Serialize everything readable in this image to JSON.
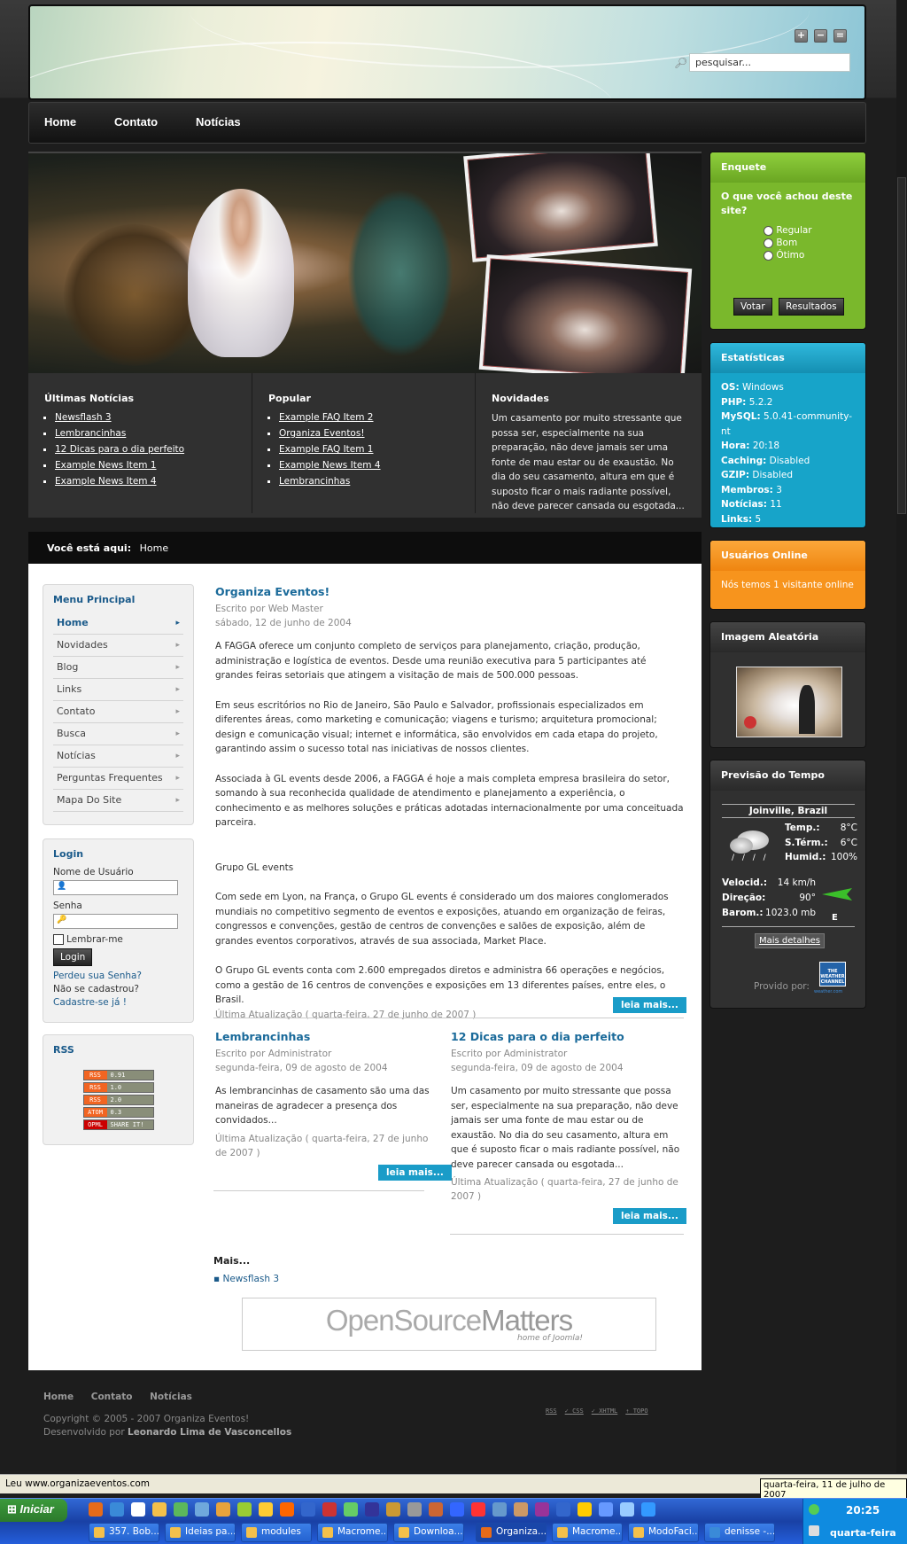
{
  "header": {
    "search_placeholder": "pesquisar..."
  },
  "nav": {
    "items": [
      "Home",
      "Contato",
      "Notícias"
    ]
  },
  "news_columns": {
    "latest": {
      "title": "Últimas Notícias",
      "items": [
        "Newsflash 3",
        "Lembrancinhas",
        "12 Dicas para o dia perfeito",
        "Example News Item 1",
        "Example News Item 4"
      ]
    },
    "popular": {
      "title": "Popular",
      "items": [
        "Example FAQ Item 2",
        "Organiza Eventos!",
        "Example FAQ Item 1",
        "Example News Item 4",
        "Lembrancinhas"
      ]
    },
    "news": {
      "title": "Novidades",
      "text": "Um casamento por muito stressante que possa ser, especialmente na sua preparação, não deve jamais ser uma fonte de mau estar ou de exaustão. No dia do seu casamento, altura em que é suposto ficar o mais radiante possível, não deve parecer cansada ou esgotada..."
    }
  },
  "breadcrumb": {
    "label": "Você está aqui:",
    "current": "Home"
  },
  "main_menu": {
    "title": "Menu Principal",
    "items": [
      "Home",
      "Novidades",
      "Blog",
      "Links",
      "Contato",
      "Busca",
      "Notícias",
      "Perguntas Frequentes",
      "Mapa Do Site"
    ]
  },
  "login": {
    "title": "Login",
    "username_label": "Nome de Usuário",
    "password_label": "Senha",
    "remember_label": "Lembrar-me",
    "button": "Login",
    "forgot": "Perdeu sua Senha?",
    "not_registered": "Não se cadastrou?",
    "register": "Cadastre-se já !"
  },
  "rss": {
    "title": "RSS",
    "feeds": [
      {
        "a": "RSS",
        "b": "0.91"
      },
      {
        "a": "RSS",
        "b": "1.0"
      },
      {
        "a": "RSS",
        "b": "2.0"
      },
      {
        "a": "ATOM",
        "b": "0.3"
      },
      {
        "a": "OPML",
        "b": "SHARE IT!"
      }
    ]
  },
  "article": {
    "title": "Organiza Eventos!",
    "author": "Escrito por Web Master",
    "date": "sábado, 12 de junho de 2004",
    "paragraphs": [
      "A FAGGA oferece um conjunto completo de serviços para planejamento, criação, produção, administração e logística de eventos. Desde uma reunião executiva para 5 participantes até grandes feiras setoriais que atingem a visitação de mais de 500.000 pessoas.",
      "Em seus escritórios no Rio de Janeiro, São Paulo e Salvador, profissionais especializados em diferentes áreas, como marketing e comunicação; viagens e turismo; arquitetura promocional; design e comunicação visual; internet e informática, são envolvidos em cada etapa do projeto, garantindo assim o sucesso total nas iniciativas de nossos clientes.",
      "Associada à GL events desde 2006, a FAGGA é hoje a mais completa empresa brasileira do setor, somando à sua reconhecida qualidade de atendimento e planejamento a experiência, o conhecimento e as melhores soluções e práticas adotadas internacionalmente por uma conceituada parceira.",
      "Grupo GL events",
      "Com sede em Lyon, na França, o Grupo GL events é considerado um dos maiores conglomerados mundiais no competitivo segmento de eventos e exposições, atuando em organização de feiras, congressos e convenções, gestão de centros de convenções e salões de exposição, além de grandes eventos corporativos, através de sua associada, Market Place.",
      "O Grupo GL events conta com 2.600 empregados diretos e administra 66 operações e negócios, como a gestão de 16 centros de convenções e exposições em 13 diferentes países, entre eles, o Brasil."
    ],
    "updated": "Última Atualização ( quarta-feira, 27 de junho de 2007 )",
    "readmore": "leia mais..."
  },
  "article2": {
    "title": "Lembrancinhas",
    "author": "Escrito por Administrator",
    "date": "segunda-feira, 09 de agosto de 2004",
    "text": "As lembrancinhas de casamento são uma das maneiras de agradecer a presença dos convidados...",
    "updated": "Última Atualização ( quarta-feira, 27 de junho de 2007 )",
    "readmore": "leia mais..."
  },
  "article3": {
    "title": "12 Dicas para o dia perfeito",
    "author": "Escrito por Administrator",
    "date": "segunda-feira, 09 de agosto de 2004",
    "text": "Um casamento por muito stressante que possa ser, especialmente na sua preparação, não deve jamais ser uma fonte de mau estar ou de exaustão. No dia do seu casamento, altura em que é suposto ficar o mais radiante possível, não deve parecer cansada ou esgotada...",
    "updated": "Última Atualização ( quarta-feira, 27 de junho de 2007 )",
    "readmore": "leia mais..."
  },
  "more": {
    "title": "Mais...",
    "items": [
      "Newsflash 3"
    ]
  },
  "osm_logo": {
    "text_a": "OpenSource",
    "text_b": "Matters",
    "tagline": "home of Joomla!"
  },
  "poll": {
    "title": "Enquete",
    "question": "O que você achou deste site?",
    "options": [
      "Regular",
      "Bom",
      "Ótimo"
    ],
    "vote": "Votar",
    "results": "Resultados",
    "color": "#7ab82c"
  },
  "stats": {
    "title": "Estatísticas",
    "rows": [
      {
        "k": "OS:",
        "v": "Windows"
      },
      {
        "k": "PHP:",
        "v": "5.2.2"
      },
      {
        "k": "MySQL:",
        "v": "5.0.41-community-nt"
      },
      {
        "k": "Hora:",
        "v": "20:18"
      },
      {
        "k": "Caching:",
        "v": "Disabled"
      },
      {
        "k": "GZIP:",
        "v": "Disabled"
      },
      {
        "k": "Membros:",
        "v": "3"
      },
      {
        "k": "Notícias:",
        "v": "11"
      },
      {
        "k": "Links:",
        "v": "5"
      }
    ],
    "color": "#17a4c9"
  },
  "online": {
    "title": "Usuários Online",
    "text": "Nós temos 1 visitante online",
    "color": "#f7941d"
  },
  "random_image": {
    "title": "Imagem Aleatória"
  },
  "weather": {
    "title": "Previsão do Tempo",
    "city": "Joinville, Brazil",
    "rows": [
      {
        "k": "Temp.:",
        "v": "8°C"
      },
      {
        "k": "S.Térm.:",
        "v": "6°C"
      },
      {
        "k": "Humid.:",
        "v": "100%"
      }
    ],
    "wind_rows": [
      {
        "k": "Velocid.:",
        "v": "14 km/h"
      },
      {
        "k": "Direção:",
        "v": "90°"
      },
      {
        "k": "Barom.:",
        "v": "1023.0 mb"
      }
    ],
    "wind_dir": "E",
    "details": "Mais detalhes",
    "provided_by": "Provido por:",
    "provider": "THE WEATHER CHANNEL",
    "provider_url": "weather.com"
  },
  "footer": {
    "links": [
      "Home",
      "Contato",
      "Notícias"
    ],
    "copyright": "Copyright © 2005 - 2007 Organiza Eventos!",
    "dev_prefix": "Desenvolvido por",
    "dev_name": "Leonardo Lima de Vasconcellos",
    "badges": [
      "RSS",
      "CSS",
      "XHTML",
      "TOPO"
    ]
  },
  "statusbar": {
    "text": "Leu www.organizaeventos.com",
    "tooltip": "quarta-feira, 11 de julho de 2007"
  },
  "taskbar": {
    "start": "Iniciar",
    "buttons": [
      "357. Bob...",
      "Ideias pa...",
      "modules",
      "Macrome...",
      "Downloa...",
      "Organiza...",
      "Macrome...",
      "ModoFaci...",
      "denisse -..."
    ],
    "clock": "20:25",
    "day": "quarta-feira"
  }
}
